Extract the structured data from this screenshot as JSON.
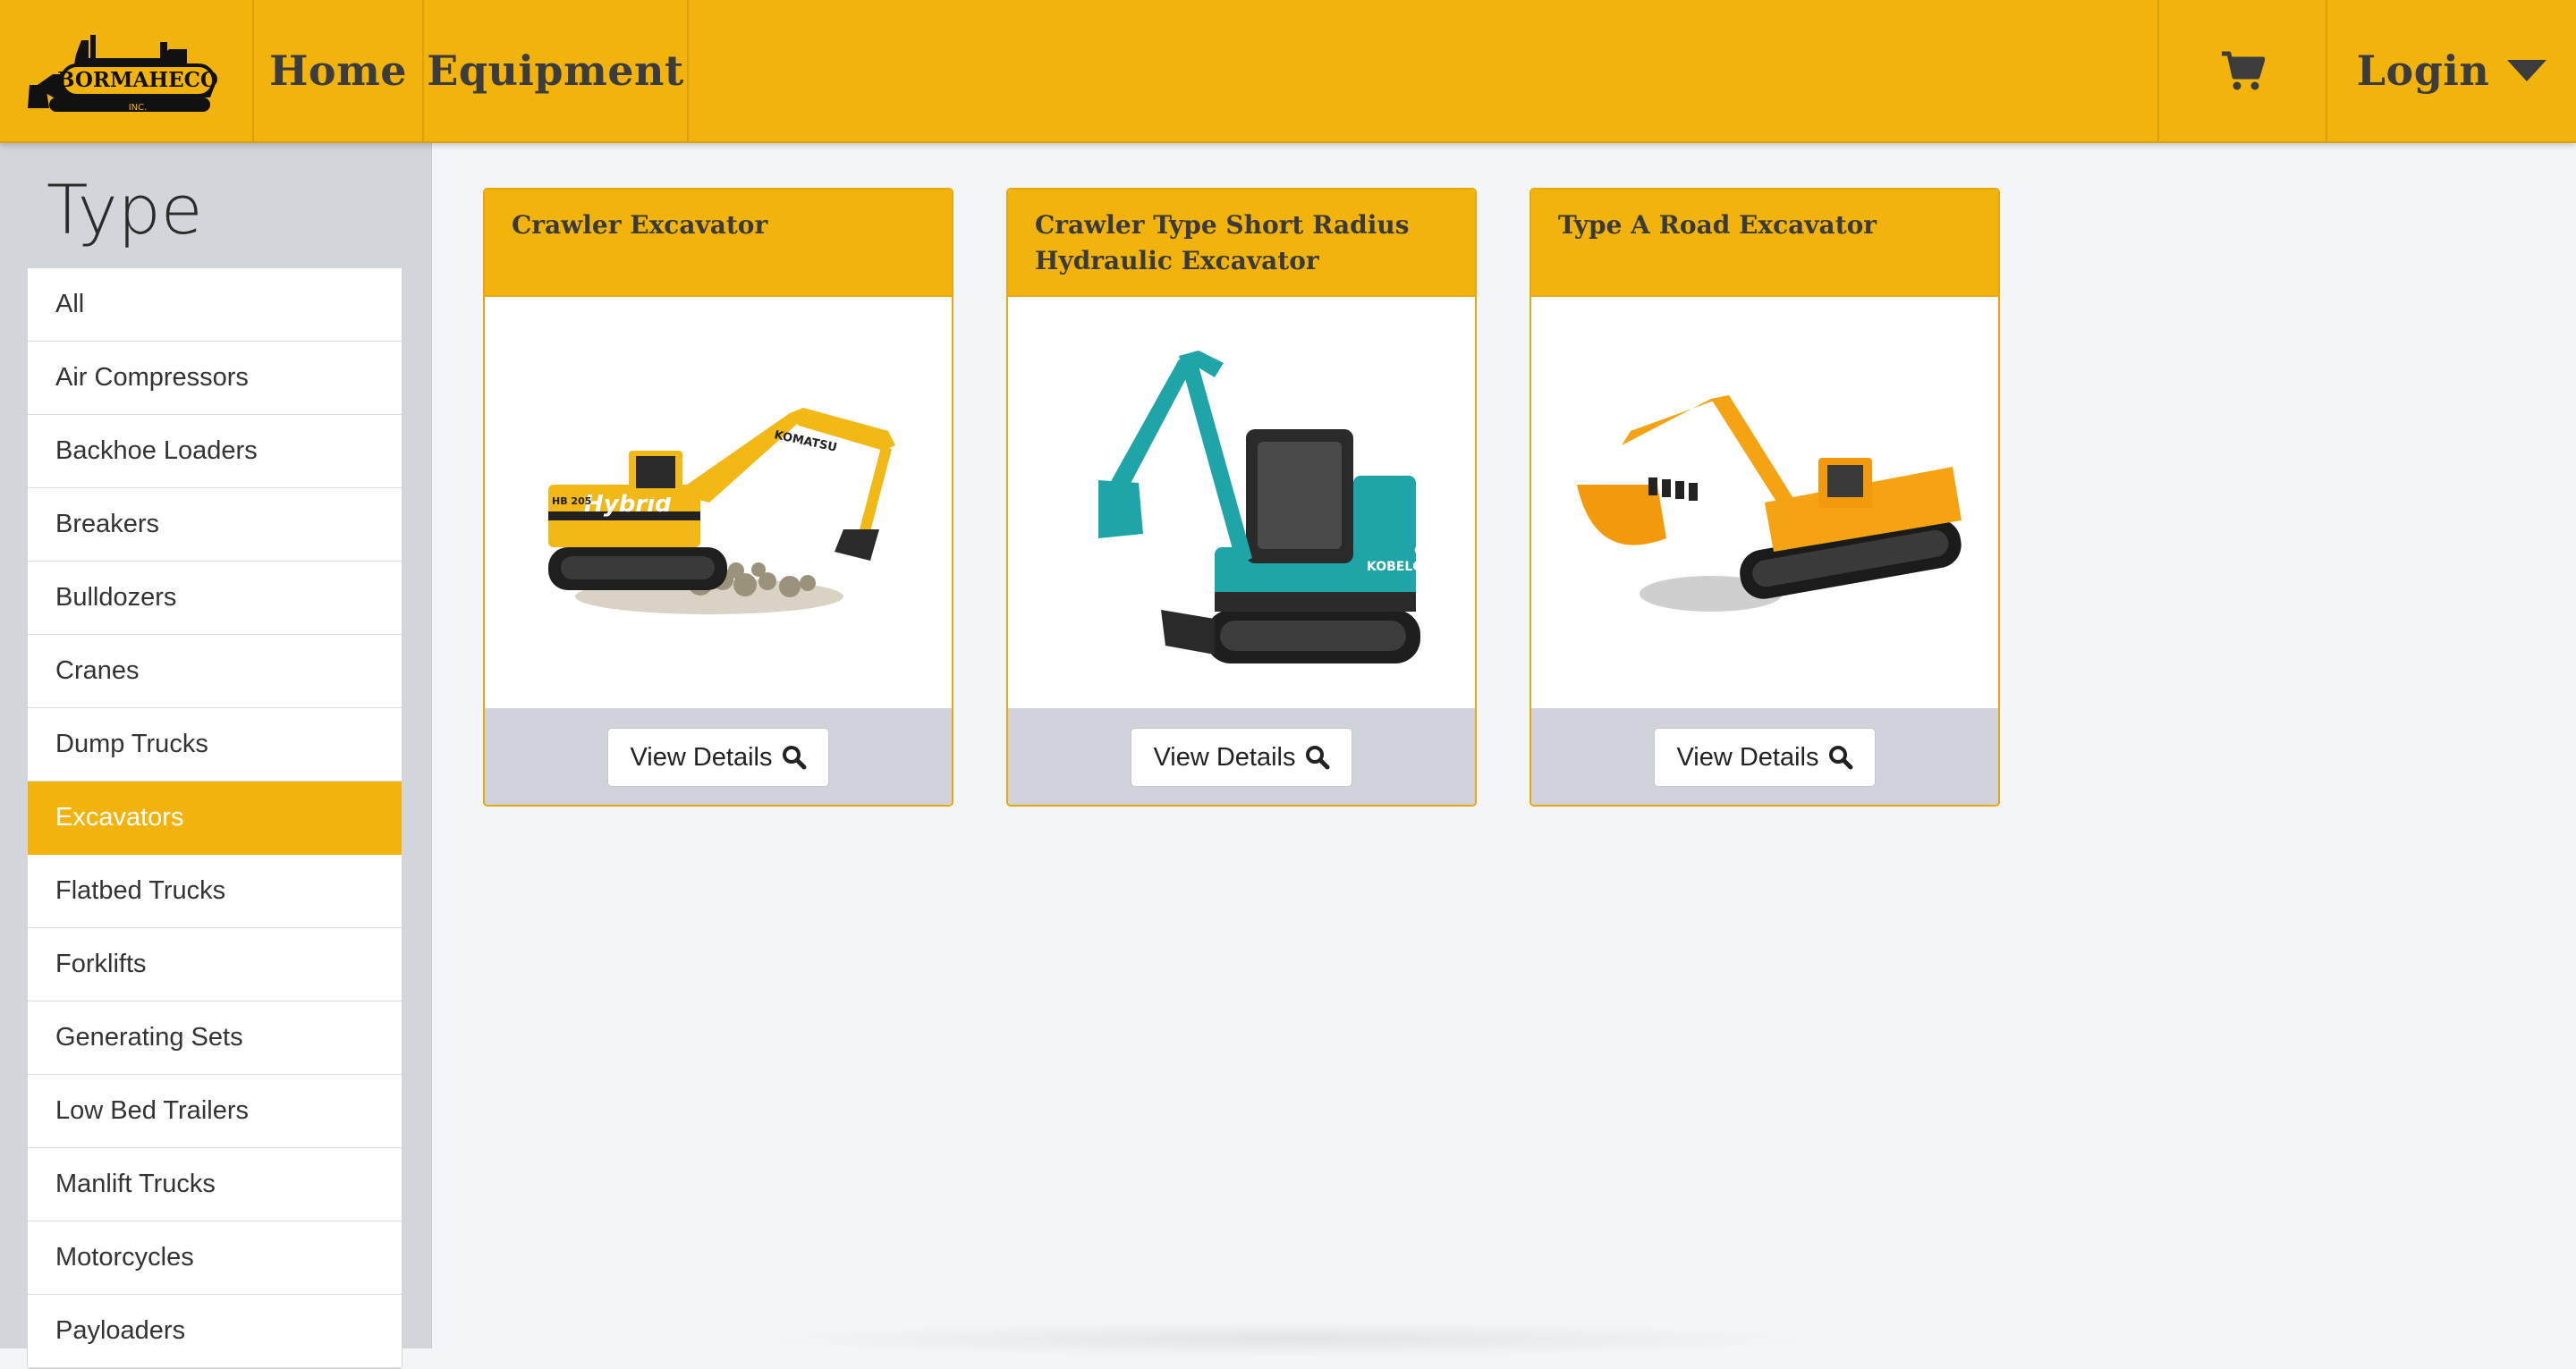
{
  "brand": {
    "logo_text": "BORMAHECO",
    "logo_sub": "INC."
  },
  "nav": {
    "home": "Home",
    "equipment": "Equipment",
    "login": "Login"
  },
  "icons": {
    "cart": "cart-icon",
    "caret": "caret-down-icon",
    "search": "search-icon"
  },
  "sidebar": {
    "title": "Type",
    "items": [
      {
        "label": "All"
      },
      {
        "label": "Air Compressors"
      },
      {
        "label": "Backhoe Loaders"
      },
      {
        "label": "Breakers"
      },
      {
        "label": "Bulldozers"
      },
      {
        "label": "Cranes"
      },
      {
        "label": "Dump Trucks"
      },
      {
        "label": "Excavators",
        "active": true
      },
      {
        "label": "Flatbed Trucks"
      },
      {
        "label": "Forklifts"
      },
      {
        "label": "Generating Sets"
      },
      {
        "label": "Low Bed Trailers"
      },
      {
        "label": "Manlift Trucks"
      },
      {
        "label": "Motorcycles"
      },
      {
        "label": "Payloaders"
      }
    ]
  },
  "cards": [
    {
      "title": "Crawler Excavator",
      "image_brand": "KOMATSU",
      "image_text": "Hybrid",
      "image_model": "HB 205",
      "button": "View Details"
    },
    {
      "title": "Crawler Type Short Radius Hydraulic Excavator",
      "image_brand": "KOBELCO",
      "button": "View Details"
    },
    {
      "title": "Type A Road Excavator",
      "button": "View Details"
    }
  ],
  "colors": {
    "accent": "#f2b40c",
    "accent_border": "#e6a80a",
    "sidebar_bg": "#d2d5da",
    "page_bg": "#f4f5f9",
    "teal": "#1fa4a8"
  }
}
